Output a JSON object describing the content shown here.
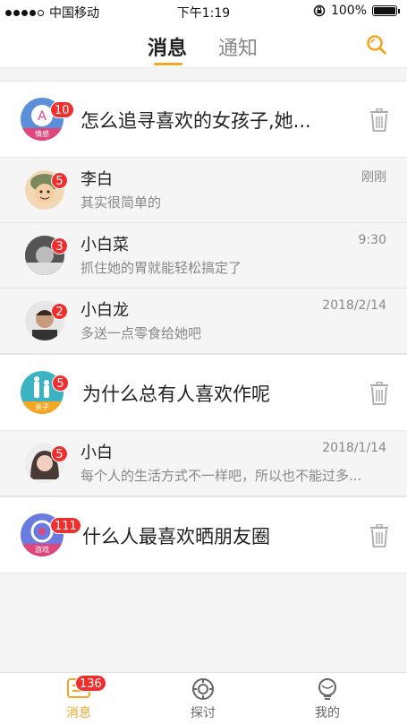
{
  "status_bar": {
    "carrier": "中国移动",
    "time": "下午1:19",
    "battery": "100%"
  },
  "header": {
    "tabs": [
      "消息",
      "通知"
    ]
  },
  "groups": [
    {
      "avatar_tag": "情感",
      "badge": "10",
      "title": "怎么追寻喜欢的女孩子,她...",
      "messages": [
        {
          "name": "李白",
          "time": "刚刚",
          "preview": "其实很简单的",
          "badge": "5"
        },
        {
          "name": "小白菜",
          "time": "9:30",
          "preview": "抓住她的胃就能轻松搞定了",
          "badge": "3"
        },
        {
          "name": "小白龙",
          "time": "2018/2/14",
          "preview": "多送一点零食给她吧",
          "badge": "2"
        }
      ]
    },
    {
      "avatar_tag": "亲子",
      "badge": "5",
      "title": "为什么总有人喜欢作呢",
      "messages": [
        {
          "name": "小白",
          "time": "2018/1/14",
          "preview": "每个人的生活方式不一样吧，所以也不能过多...",
          "badge": "5"
        }
      ]
    },
    {
      "avatar_tag": "游戏",
      "badge": "111",
      "title": "什么人最喜欢晒朋友圈",
      "messages": []
    }
  ],
  "tabbar": {
    "items": [
      {
        "label": "消息",
        "badge": "136"
      },
      {
        "label": "探讨"
      },
      {
        "label": "我的"
      }
    ]
  },
  "colors": {
    "accent": "#f5a623",
    "badge": "#f02e2e",
    "group_avatar": "#5b8fd9"
  }
}
